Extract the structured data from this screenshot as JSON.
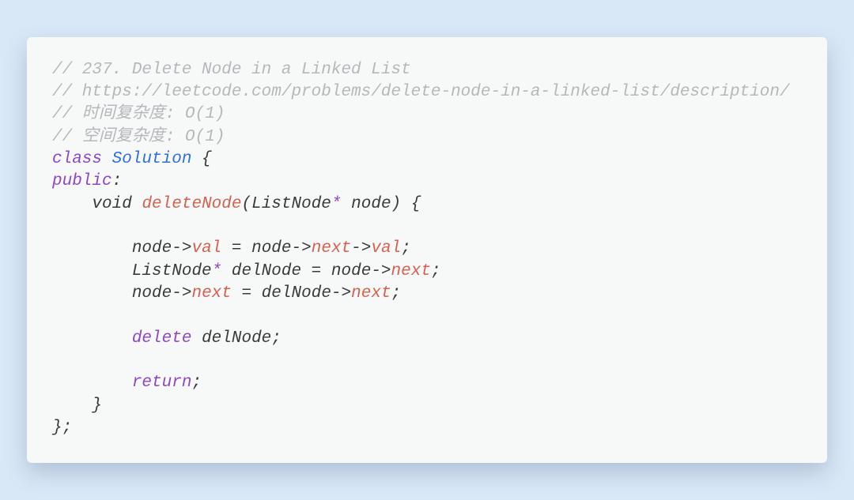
{
  "code": {
    "comment_lines": [
      "// 237. Delete Node in a Linked List",
      "// https://leetcode.com/problems/delete-node-in-a-linked-list/description/",
      "// 时间复杂度: O(1)",
      "// 空间复杂度: O(1)"
    ],
    "kw_class": "class",
    "classname": "Solution",
    "brace_open": " {",
    "kw_public": "public",
    "colon": ":",
    "indent1": "    ",
    "indent2": "        ",
    "ret_void": "void",
    "funcname": "deleteNode",
    "paren_open": "(",
    "param_type": "ListNode",
    "star": "*",
    "param_name": " node",
    "paren_close_brace": ") {",
    "stmt1_a": "node",
    "arrow": "->",
    "val": "val",
    "eq": " = ",
    "next": "next",
    "semi": ";",
    "listnode": "ListNode",
    "delnode_decl": " delNode = ",
    "delnode": "delNode",
    "kw_delete": "delete",
    "space": " ",
    "kw_return": "return",
    "brace_close_inner": "}",
    "brace_close_outer": "};"
  }
}
